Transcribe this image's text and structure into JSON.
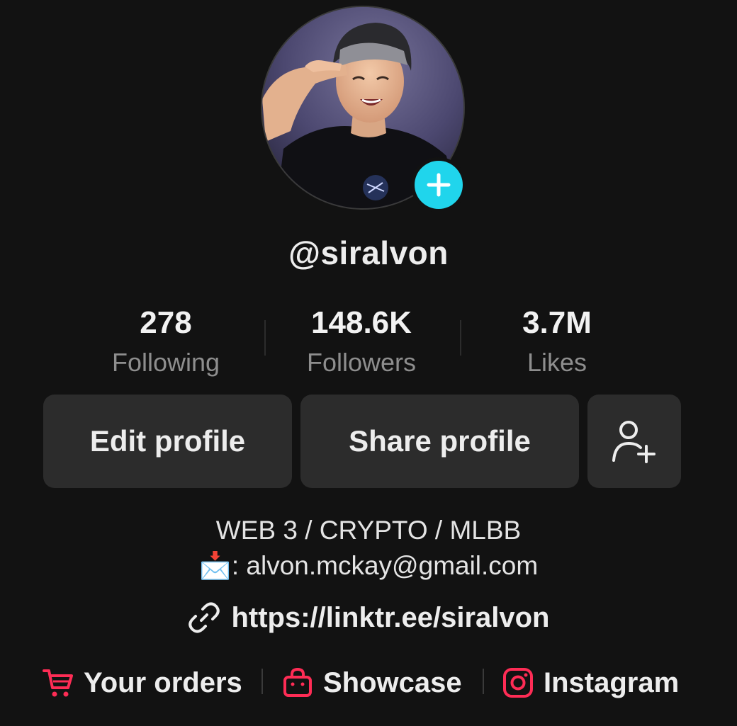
{
  "profile": {
    "username": "@siralvon"
  },
  "stats": {
    "following": {
      "value": "278",
      "label": "Following"
    },
    "followers": {
      "value": "148.6K",
      "label": "Followers"
    },
    "likes": {
      "value": "3.7M",
      "label": "Likes"
    }
  },
  "actions": {
    "edit_label": "Edit profile",
    "share_label": "Share profile",
    "add_friend_icon": "person-add-icon"
  },
  "bio": {
    "line1": "WEB 3 / CRYPTO / MLBB",
    "email_prefix": "📩",
    "email_line": ": alvon.mckay@gmail.com",
    "link": "https://linktr.ee/siralvon"
  },
  "bottom_links": {
    "orders": "Your orders",
    "showcase": "Showcase",
    "instagram": "Instagram"
  },
  "colors": {
    "background": "#121212",
    "accent_cyan": "#20d5ec",
    "accent_red": "#fe2c55",
    "button_bg": "#2c2c2c"
  }
}
